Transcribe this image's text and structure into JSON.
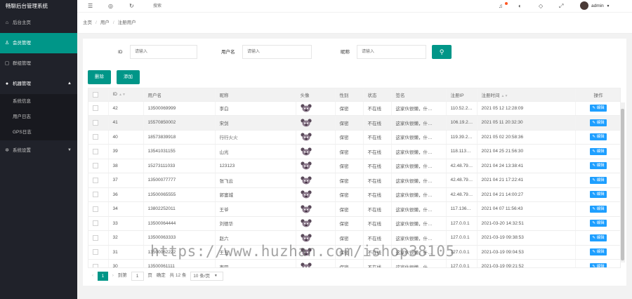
{
  "app": {
    "title": "畅聊后台管理系统"
  },
  "sidebar": {
    "items": [
      {
        "label": "后台主页",
        "icon": "home-icon"
      },
      {
        "label": "会员管理",
        "icon": "user-icon"
      },
      {
        "label": "群组管理",
        "icon": "group-icon"
      },
      {
        "label": "机器管理",
        "icon": "robot-icon"
      },
      {
        "label": "系统设置",
        "icon": "gear-icon"
      }
    ],
    "subitems": [
      "系统信息",
      "用户日志",
      "GPS日志"
    ]
  },
  "topbar": {
    "search_placeholder": "搜索",
    "user_name": "admin"
  },
  "breadcrumb": [
    "主页",
    "用户",
    "注册用户"
  ],
  "filters": {
    "id_label": "ID",
    "username_label": "用户名",
    "nickname_label": "昵称",
    "placeholder": "请输入"
  },
  "buttons": {
    "delete": "删除",
    "add": "添加",
    "edit": "编辑"
  },
  "table": {
    "headers": [
      "ID",
      "用户名",
      "昵称",
      "头像",
      "性别",
      "状态",
      "签名",
      "注册IP",
      "注册时间",
      "操作"
    ],
    "rows": [
      [
        "42",
        "13500069999",
        "李白",
        "保密",
        "不在线",
        "这家伙很懒，什…",
        "110.52.2…",
        "2021 05 12 12:28:09"
      ],
      [
        "41",
        "15570850002",
        "宋剑",
        "保密",
        "不在线",
        "这家伙很懒，什…",
        "106.19.2…",
        "2021 05 11 20:32:30"
      ],
      [
        "40",
        "18573839918",
        "行行火火",
        "保密",
        "不在线",
        "这家伙很懒，什…",
        "119.39.2…",
        "2021 05 02 20:58:36"
      ],
      [
        "39",
        "13541031155",
        "山光",
        "保密",
        "不在线",
        "这家伙很懒，什…",
        "118.113…",
        "2021 04 25 21:56:30"
      ],
      [
        "38",
        "15273111033",
        "123123",
        "保密",
        "不在线",
        "这家伙很懒，什…",
        "42.48.79…",
        "2021 04 24 13:38:41"
      ],
      [
        "37",
        "13500077777",
        "张飞云",
        "保密",
        "不在线",
        "这家伙很懒，什…",
        "42.48.79…",
        "2021 04 21 17:22:41"
      ],
      [
        "36",
        "13500065555",
        "郭富城",
        "保密",
        "不在线",
        "这家伙很懒，什…",
        "42.48.79…",
        "2021 04 21 14:00:27"
      ],
      [
        "34",
        "13802252011",
        "王爷",
        "保密",
        "不在线",
        "这家伙很懒，什…",
        "117.136…",
        "2021 04 07 11:56:43"
      ],
      [
        "33",
        "13500064444",
        "刘德华",
        "保密",
        "不在线",
        "这家伙很懒，什…",
        "127.0.0.1",
        "2021-03-20 14:32:51"
      ],
      [
        "32",
        "13500063333",
        "赵六",
        "保密",
        "不在线",
        "这家伙很懒，什…",
        "127.0.0.1",
        "2021-03-19 09:38:53"
      ],
      [
        "31",
        "13500062222",
        "王五",
        "保密",
        "不在线",
        "这家伙很懒，什…",
        "127.0.0.1",
        "2021-03-19 09:04:53"
      ],
      [
        "30",
        "13500061111",
        "李四",
        "保密",
        "不在线",
        "这家伙很懒，什…",
        "127.0.0.1",
        "2021-03-19 09:21:52"
      ]
    ]
  },
  "pager": {
    "current": "1",
    "goto_label": "到第",
    "page_value": "1",
    "page_unit": "页",
    "confirm": "确定",
    "total": "共 12 条",
    "per_page": "10 条/页"
  },
  "watermark": "https://www.huzhan.com/ishop38105",
  "colors": {
    "accent": "#009688",
    "sidebar_bg": "#20222a",
    "edit_button": "#1e9fff"
  }
}
